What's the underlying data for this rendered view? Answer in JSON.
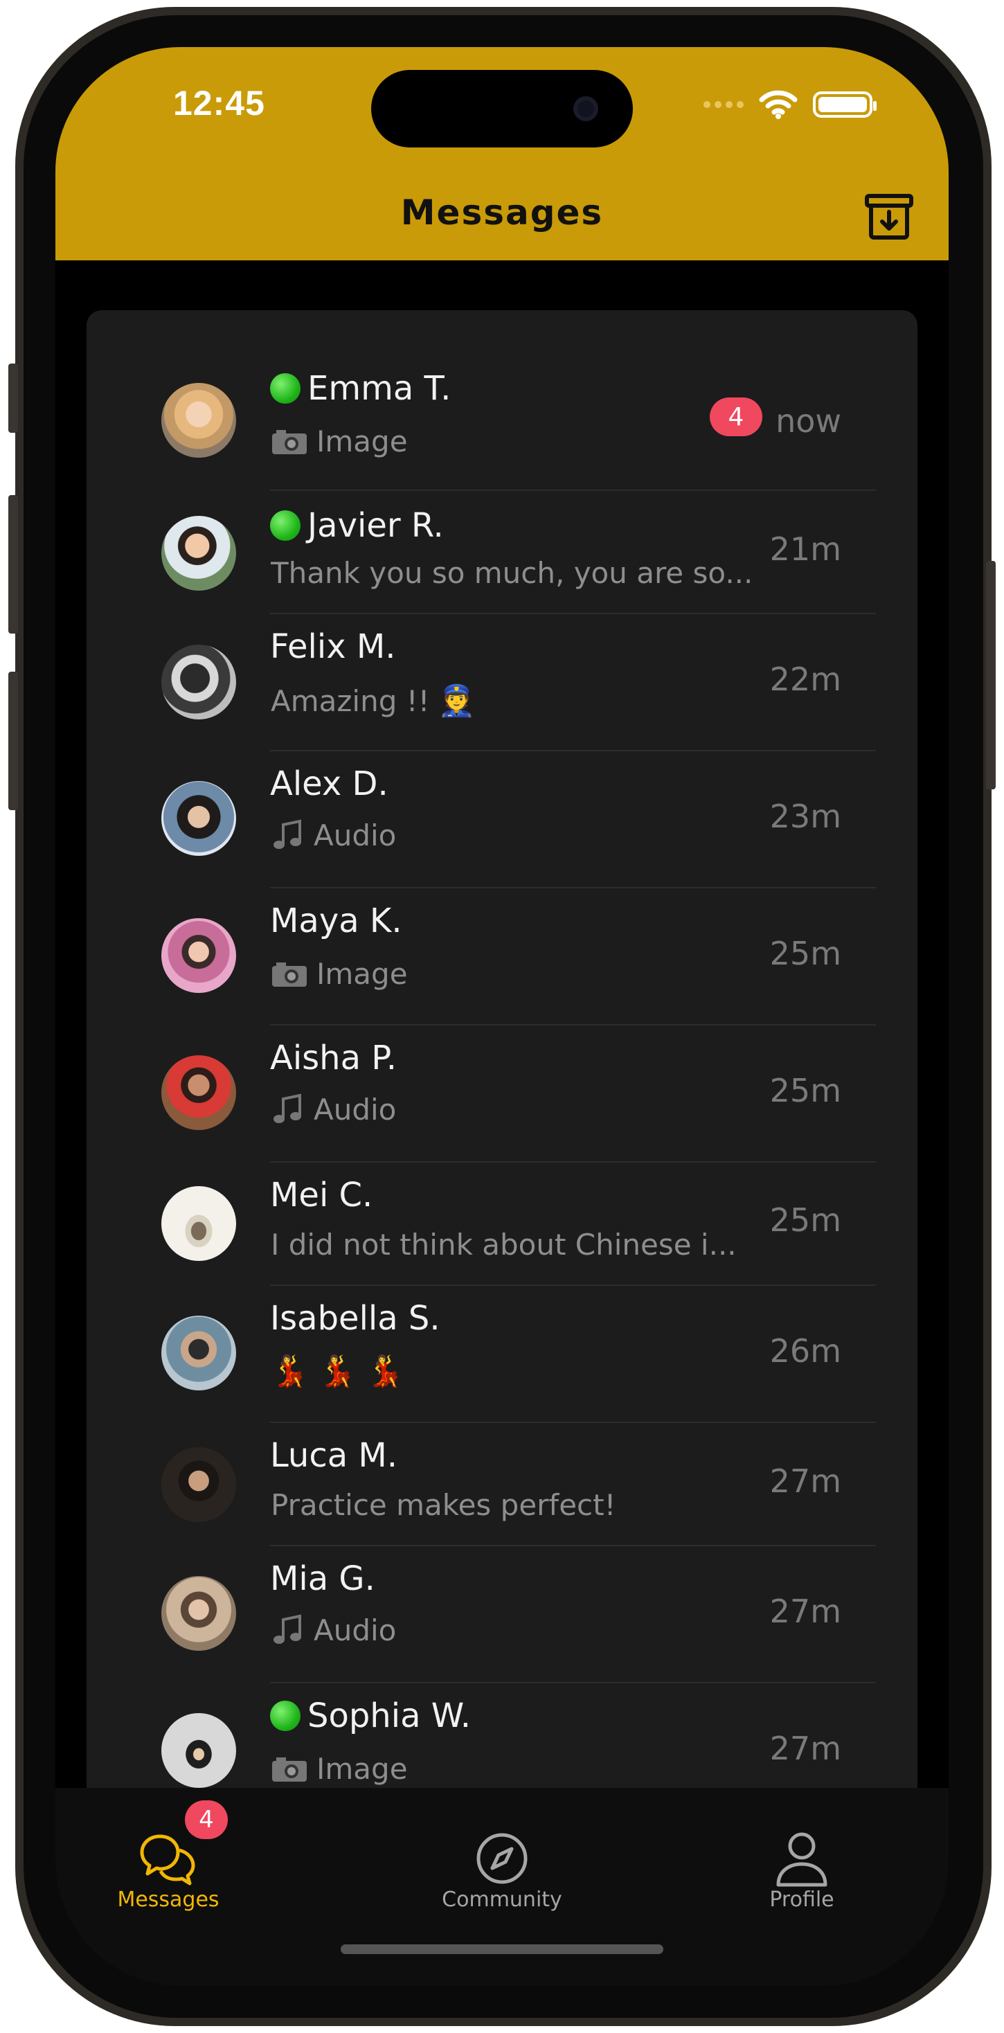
{
  "status_bar": {
    "time": "12:45"
  },
  "header": {
    "title": "Messages",
    "archive_icon": "archive-download-icon",
    "color": "#c99b08"
  },
  "conversations": [
    {
      "name": "Emma T.",
      "online": true,
      "preview_icon": "camera",
      "preview": "Image",
      "time": "now",
      "unread": "4"
    },
    {
      "name": "Javier R.",
      "online": true,
      "preview_icon": "",
      "preview": "Thank you so much, you are so...",
      "time": "21m"
    },
    {
      "name": "Felix M.",
      "online": false,
      "preview_icon": "",
      "preview": "Amazing !!",
      "preview_emoji": "👮",
      "time": "22m"
    },
    {
      "name": "Alex D.",
      "online": false,
      "preview_icon": "music-note",
      "preview": "Audio",
      "time": "23m"
    },
    {
      "name": "Maya K.",
      "online": false,
      "preview_icon": "camera",
      "preview": "Image",
      "time": "25m"
    },
    {
      "name": "Aisha P.",
      "online": false,
      "preview_icon": "music-note",
      "preview": "Audio",
      "time": "25m"
    },
    {
      "name": "Mei C.",
      "online": false,
      "preview_icon": "",
      "preview": "I did not think about Chinese i...",
      "time": "25m"
    },
    {
      "name": "Isabella S.",
      "online": false,
      "preview_icon": "",
      "preview": "",
      "preview_emoji": "💃 💃 💃",
      "time": "26m"
    },
    {
      "name": "Luca M.",
      "online": false,
      "preview_icon": "",
      "preview": "Practice makes perfect!",
      "time": "27m"
    },
    {
      "name": "Mia G.",
      "online": false,
      "preview_icon": "music-note",
      "preview": "Audio",
      "time": "27m"
    },
    {
      "name": "Sophia W.",
      "online": true,
      "preview_icon": "camera",
      "preview": "Image",
      "time": "27m"
    }
  ],
  "tabbar": {
    "messages": {
      "label": "Messages",
      "badge": "4",
      "icon": "chat-bubbles-icon",
      "active": true
    },
    "community": {
      "label": "Community",
      "icon": "compass-icon"
    },
    "profile": {
      "label": "Profile",
      "icon": "person-icon"
    }
  },
  "colors": {
    "accent": "#c99b08",
    "active_tab": "#f2b705",
    "badge": "#f0485f",
    "online": "#1fb61a"
  }
}
